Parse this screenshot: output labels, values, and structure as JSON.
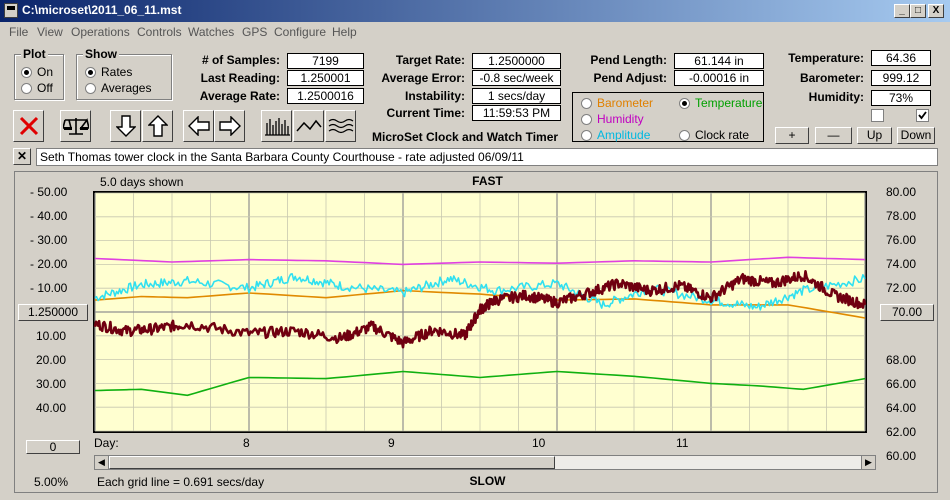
{
  "window": {
    "title": "C:\\microset\\2011_06_11.mst",
    "minimize": "_",
    "maximize": "□",
    "close": "X"
  },
  "menu": [
    "File",
    "View",
    "Operations",
    "Controls",
    "Watches",
    "GPS",
    "Configure",
    "Help"
  ],
  "plot_group": {
    "legend": "Plot",
    "options": [
      "On",
      "Off"
    ],
    "selected": 0
  },
  "show_group": {
    "legend": "Show",
    "options": [
      "Rates",
      "Averages"
    ],
    "selected": 0
  },
  "stats": {
    "samples_label": "# of Samples:",
    "samples": "7199",
    "last_reading_label": "Last Reading:",
    "last_reading": "1.250001",
    "average_rate_label": "Average Rate:",
    "average_rate": "1.2500016",
    "target_rate_label": "Target Rate:",
    "target_rate": "1.2500000",
    "average_error_label": "Average Error:",
    "average_error": "-0.8 sec/week",
    "instability_label": "Instability:",
    "instability": "1 secs/day",
    "current_time_label": "Current Time:",
    "current_time": "11:59:53 PM",
    "pend_length_label": "Pend Length:",
    "pend_length": "61.144 in",
    "pend_adjust_label": "Pend Adjust:",
    "pend_adjust": "-0.00016 in",
    "temperature_label": "Temperature:",
    "temperature": "64.36",
    "barometer_label": "Barometer:",
    "barometer": "999.12",
    "humidity_label": "Humidity:",
    "humidity": "73%"
  },
  "app_name": "MicroSet Clock and Watch Timer",
  "sensor_options": [
    {
      "label": "Barometer",
      "color": "#e08000",
      "checked": false
    },
    {
      "label": "Temperature",
      "color": "#00a000",
      "checked": true
    },
    {
      "label": "Humidity",
      "color": "#c000c0",
      "checked": false
    },
    {
      "label": "Amplitude",
      "color": "#00c8e8",
      "checked": false
    },
    {
      "label": "Clock rate",
      "color": "#000000",
      "checked": false
    }
  ],
  "sensor_buttons": {
    "plus": "+",
    "minus": "—",
    "up": "Up",
    "down": "Down"
  },
  "description": "Seth Thomas tower clock in the Santa Barbara County Courthouse - rate adjusted 06/09/11",
  "plot": {
    "days_shown": "5.0 days shown",
    "fast_label": "FAST",
    "slow_label": "SLOW",
    "center_value": "1.250000",
    "right_value": "70.00",
    "zoom_value": "0",
    "percent": "5.00%",
    "grid_note": "Each grid line = 0.691 secs/day",
    "day_label": "Day:"
  },
  "chart_data": {
    "type": "line",
    "left_ticks": [
      "- 50.00",
      "- 40.00",
      "- 30.00",
      "- 20.00",
      "- 10.00",
      "10.00",
      "20.00",
      "30.00",
      "40.00"
    ],
    "right_ticks": [
      "80.00",
      "78.00",
      "76.00",
      "74.00",
      "72.00",
      "70.00",
      "68.00",
      "66.00",
      "64.00",
      "62.00",
      "60.00"
    ],
    "x_ticks": [
      "8",
      "9",
      "10",
      "11"
    ],
    "xlim": [
      7,
      12
    ],
    "ylim_right": [
      60,
      80
    ],
    "series": [
      {
        "color": "#e040e0",
        "points": [
          [
            7,
            74.5
          ],
          [
            7.5,
            74.2
          ],
          [
            8,
            74.4
          ],
          [
            8.5,
            74.3
          ],
          [
            9,
            74.0
          ],
          [
            9.5,
            74.2
          ],
          [
            10,
            74.1
          ],
          [
            10.5,
            74.3
          ],
          [
            11,
            74.2
          ],
          [
            11.5,
            74.6
          ],
          [
            12,
            74.4
          ]
        ]
      },
      {
        "color": "#e08a00",
        "points": [
          [
            7,
            71.0
          ],
          [
            7.3,
            71.3
          ],
          [
            7.6,
            71.2
          ],
          [
            8,
            71.6
          ],
          [
            8.5,
            71.2
          ],
          [
            9,
            71.8
          ],
          [
            9.5,
            71.5
          ],
          [
            10,
            71.0
          ],
          [
            10.5,
            71.1
          ],
          [
            11,
            70.6
          ],
          [
            11.5,
            70.6
          ],
          [
            12,
            69.5
          ]
        ]
      },
      {
        "color": "#30e0f0",
        "points": [
          [
            7,
            71.2
          ],
          [
            7.3,
            72.3
          ],
          [
            7.6,
            72.6
          ],
          [
            8,
            72.0
          ],
          [
            8.3,
            73.0
          ],
          [
            8.6,
            72.2
          ],
          [
            9,
            71.6
          ],
          [
            9.3,
            72.8
          ],
          [
            9.6,
            71.8
          ],
          [
            10,
            72.4
          ],
          [
            10.3,
            70.6
          ],
          [
            10.6,
            72.0
          ],
          [
            11,
            71.0
          ],
          [
            11.3,
            70.4
          ],
          [
            11.6,
            71.8
          ],
          [
            12,
            72.8
          ]
        ]
      },
      {
        "color": "#700010",
        "points": [
          [
            7,
            69.0
          ],
          [
            7.2,
            68.4
          ],
          [
            7.4,
            68.6
          ],
          [
            7.6,
            69.0
          ],
          [
            8,
            68.2
          ],
          [
            8.3,
            68.4
          ],
          [
            8.6,
            67.8
          ],
          [
            8.8,
            68.8
          ],
          [
            9,
            67.4
          ],
          [
            9.2,
            68.5
          ],
          [
            9.4,
            68.0
          ],
          [
            9.5,
            70.2
          ],
          [
            9.6,
            71.0
          ],
          [
            9.8,
            71.4
          ],
          [
            10,
            70.8
          ],
          [
            10.2,
            71.6
          ],
          [
            10.4,
            72.4
          ],
          [
            10.6,
            71.8
          ],
          [
            10.8,
            72.2
          ],
          [
            11,
            71.2
          ],
          [
            11.2,
            72.8
          ],
          [
            11.4,
            72.4
          ],
          [
            11.6,
            73.1
          ],
          [
            11.8,
            71.4
          ],
          [
            12,
            70.6
          ]
        ]
      },
      {
        "color": "#10b010",
        "points": [
          [
            7,
            63.4
          ],
          [
            7.3,
            63.5
          ],
          [
            7.6,
            63.0
          ],
          [
            8,
            64.5
          ],
          [
            8.5,
            64.4
          ],
          [
            9,
            65.0
          ],
          [
            9.5,
            64.5
          ],
          [
            10,
            65.0
          ],
          [
            10.5,
            64.6
          ],
          [
            11,
            64.0
          ],
          [
            11.3,
            63.8
          ],
          [
            11.6,
            63.5
          ],
          [
            12,
            64.4
          ]
        ]
      }
    ]
  }
}
